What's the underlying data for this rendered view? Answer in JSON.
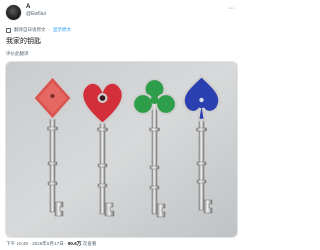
{
  "author": {
    "display_name": "A",
    "handle": "@Ew6iui"
  },
  "toolbar": {
    "more_label": "···"
  },
  "translation": {
    "notice": "翻译自日语原文",
    "show_original": "显示原文"
  },
  "tweet": {
    "text": "我家的钥匙",
    "rate_translation": "评价此翻译"
  },
  "photo": {
    "keys": [
      {
        "suit": "diamond",
        "color": "#d9534f"
      },
      {
        "suit": "heart",
        "color": "#d32f3a"
      },
      {
        "suit": "club",
        "color": "#2e9e4a"
      },
      {
        "suit": "spade",
        "color": "#2a3fb0"
      }
    ]
  },
  "meta": {
    "time": "下午 10:49",
    "date": "2026年6月17日",
    "views_count": "90.6万",
    "views_label": "次查看"
  }
}
